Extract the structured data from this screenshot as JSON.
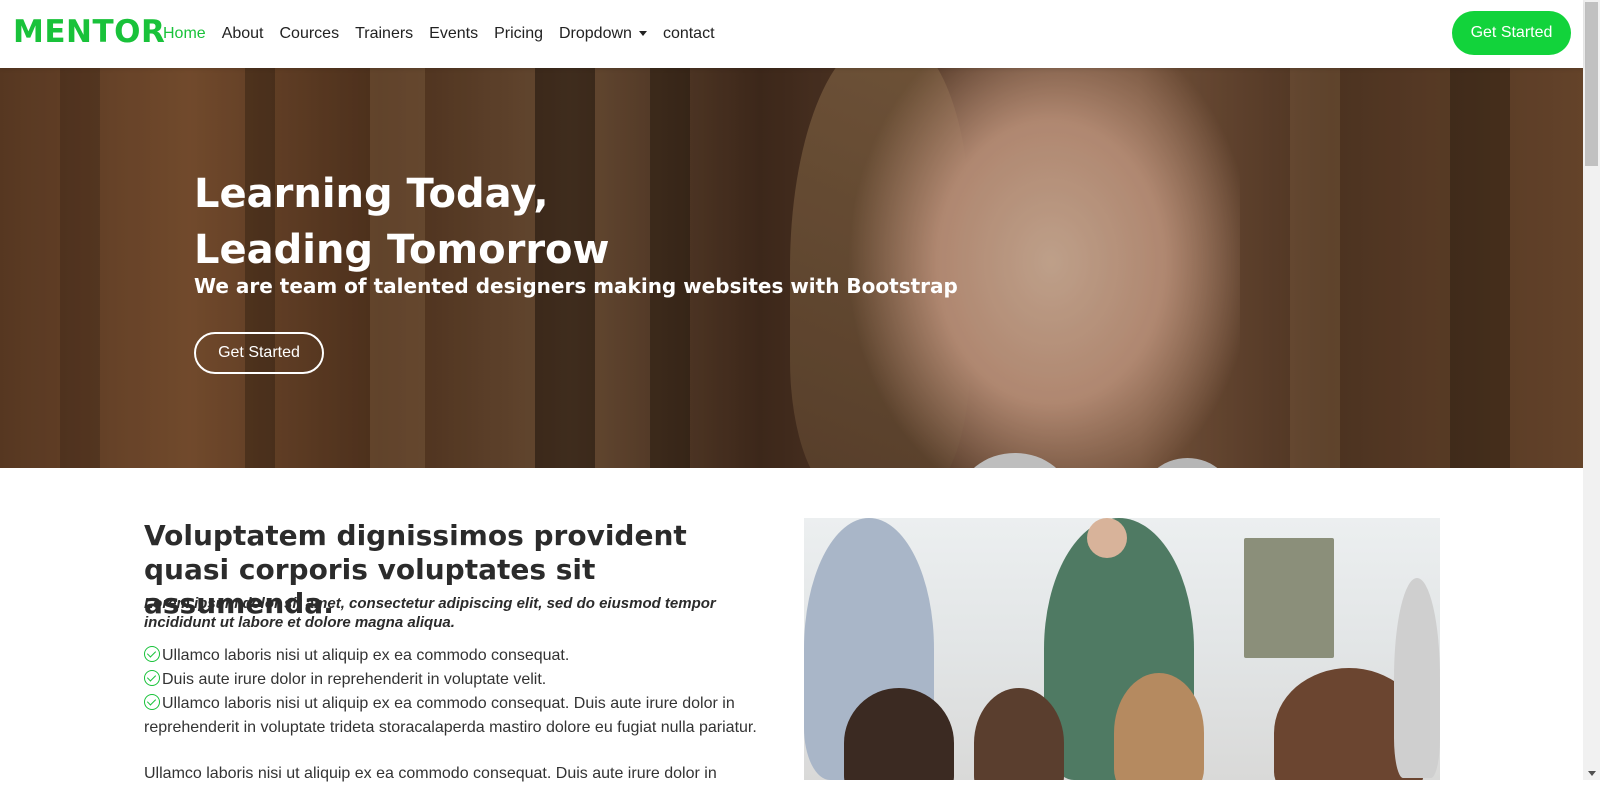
{
  "header": {
    "logo": "MENTOR",
    "nav": [
      {
        "label": "Home",
        "active": true
      },
      {
        "label": "About"
      },
      {
        "label": "Cources"
      },
      {
        "label": "Trainers"
      },
      {
        "label": "Events"
      },
      {
        "label": "Pricing"
      },
      {
        "label": "Dropdown",
        "icon": "caret-down-icon"
      },
      {
        "label": "contact"
      }
    ],
    "cta": "Get Started"
  },
  "hero": {
    "title_line1": "Learning Today,",
    "title_line2": "Leading Tomorrow",
    "subtitle": "We are team of talented designers making websites with Bootstrap",
    "cta": "Get Started"
  },
  "about": {
    "title": "Voluptatem dignissimos provident quasi corporis voluptates sit assumenda.",
    "lead": "Lorem ipsum dolor sit amet, consectetur adipiscing elit, sed do eiusmod tempor incididunt ut labore et dolore magna aliqua.",
    "items": [
      "Ullamco laboris nisi ut aliquip ex ea commodo consequat.",
      "Duis aute irure dolor in reprehenderit in voluptate velit.",
      "Ullamco laboris nisi ut aliquip ex ea commodo consequat. Duis aute irure dolor in reprehenderit in voluptate trideta storacalaperda mastiro dolore eu fugiat nulla pariatur."
    ],
    "paragraph": "Ullamco laboris nisi ut aliquip ex ea commodo consequat. Duis aute irure dolor in"
  },
  "colors": {
    "accent": "#19c23a",
    "button": "#12d33b"
  }
}
